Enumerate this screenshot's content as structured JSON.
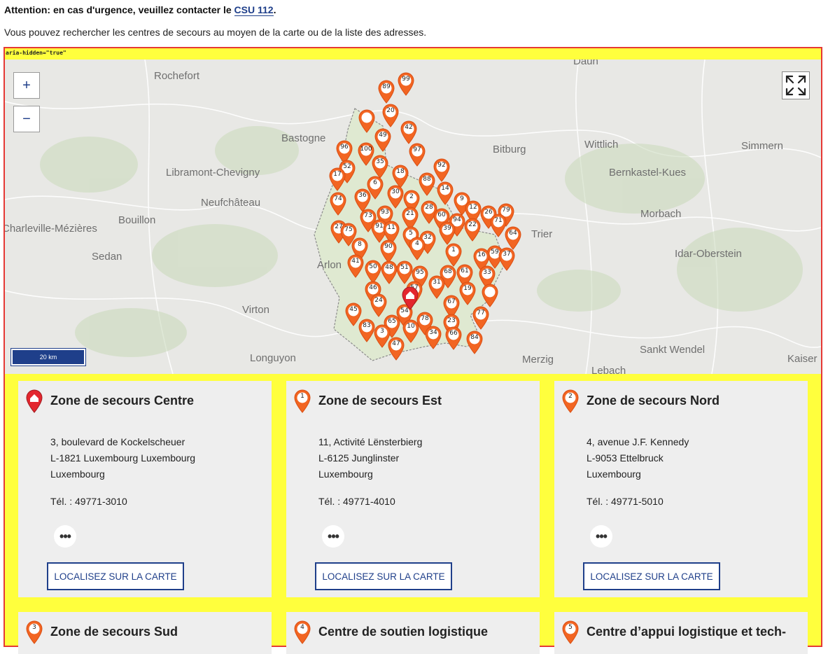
{
  "alert": {
    "text": "Attention: en cas d'urgence, veuillez contacter le ",
    "link": "CSU 112",
    "period": "."
  },
  "intro": "Vous pouvez rechercher les centres de secours au moyen de la carte ou de la liste des adresses.",
  "map": {
    "aria_label": "aria-hidden=\"true\"",
    "zoom_in": "+",
    "zoom_out": "−",
    "scale": "20 km",
    "places": [
      "Daun",
      "Rochefort",
      "Bastogne",
      "Bitburg",
      "Wittlich",
      "Simmern",
      "Libramont-Chevigny",
      "Bernkastel-Kues",
      "Neufchâteau",
      "Morbach",
      "Bouillon",
      "Charleville-Mézières",
      "Trier",
      "Sedan",
      "Idar-Oberstein",
      "Arlon",
      "Virton",
      "Longuyon",
      "Sankt Wendel",
      "Merzig",
      "Kaiser",
      "Lebach"
    ],
    "markers": [
      "99",
      "89",
      "20",
      "",
      "42",
      "49",
      "97",
      "96",
      "100",
      "35",
      "52",
      "92",
      "17",
      "18",
      "88",
      "6",
      "14",
      "74",
      "36",
      "30",
      "2",
      "28",
      "9",
      "12",
      "26",
      "79",
      "73",
      "93",
      "21",
      "60",
      "94",
      "71",
      "27",
      "75",
      "91",
      "11",
      "5",
      "39",
      "22",
      "64",
      "8",
      "90",
      "32",
      "1",
      "4",
      "59",
      "37",
      "16",
      "41",
      "50",
      "48",
      "51",
      "95",
      "68",
      "61",
      "33",
      "46",
      "57",
      "31",
      "19",
      "",
      "45",
      "24",
      "54",
      "67",
      "77",
      "83",
      "65",
      "78",
      "23",
      "3",
      "10",
      "34",
      "66",
      "47",
      "84"
    ]
  },
  "cards": [
    {
      "icon": "home",
      "title": "Zone de secours Centre",
      "address": [
        "3, boulevard de Kockelscheuer",
        "L-1821 Luxembourg Luxembourg",
        "Luxembourg"
      ],
      "tel": "Tél. : 49771-3010",
      "button": "LOCALISEZ SUR LA CARTE"
    },
    {
      "icon": "1",
      "title": "Zone de secours Est",
      "address": [
        "11, Activité Lënsterbierg",
        "L-6125 Junglinster",
        "Luxembourg"
      ],
      "tel": "Tél. : 49771-4010",
      "button": "LOCALISEZ SUR LA CARTE"
    },
    {
      "icon": "2",
      "title": "Zone de secours Nord",
      "address": [
        "4, avenue J.F. Kennedy",
        "L-9053 Ettelbruck",
        "Luxembourg"
      ],
      "tel": "Tél. : 49771-5010",
      "button": "LOCALISEZ SUR LA CARTE"
    },
    {
      "icon": "3",
      "title": "Zone de secours Sud"
    },
    {
      "icon": "4",
      "title": "Centre de soutien logistique"
    },
    {
      "icon": "5",
      "title": "Centre d’appui logistique et tech-"
    }
  ],
  "colors": {
    "pin": "#f26522",
    "pin_dark": "#d94e13",
    "home_pin": "#e3262e",
    "frame": "#e53935",
    "frame_bg": "#ffff3d",
    "brand": "#1f3f8a",
    "territory": "#e0eccf"
  },
  "icons": {
    "fullscreen": "expand-icon",
    "more": "more-dots-icon"
  }
}
